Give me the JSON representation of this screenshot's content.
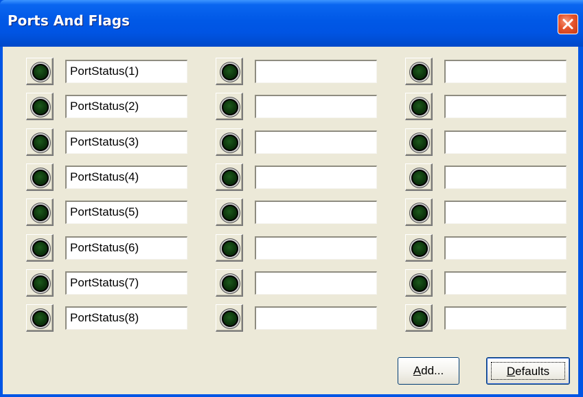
{
  "window": {
    "title": "Ports And Flags"
  },
  "icons": {
    "close": "close-icon",
    "indicator": "led-indicator-icon"
  },
  "colors": {
    "title_bar": "#0054e3",
    "client_background": "#ece9d8",
    "close_button": "#e5542c",
    "led_off": "#0d360d"
  },
  "columns": [
    {
      "rows": [
        {
          "value": "PortStatus(1)"
        },
        {
          "value": "PortStatus(2)"
        },
        {
          "value": "PortStatus(3)"
        },
        {
          "value": "PortStatus(4)"
        },
        {
          "value": "PortStatus(5)"
        },
        {
          "value": "PortStatus(6)"
        },
        {
          "value": "PortStatus(7)"
        },
        {
          "value": "PortStatus(8)"
        }
      ]
    },
    {
      "rows": [
        {
          "value": ""
        },
        {
          "value": ""
        },
        {
          "value": ""
        },
        {
          "value": ""
        },
        {
          "value": ""
        },
        {
          "value": ""
        },
        {
          "value": ""
        },
        {
          "value": ""
        }
      ]
    },
    {
      "rows": [
        {
          "value": ""
        },
        {
          "value": ""
        },
        {
          "value": ""
        },
        {
          "value": ""
        },
        {
          "value": ""
        },
        {
          "value": ""
        },
        {
          "value": ""
        },
        {
          "value": ""
        }
      ]
    }
  ],
  "buttons": {
    "add": {
      "mnemonic": "A",
      "rest": "dd..."
    },
    "defaults": {
      "mnemonic": "D",
      "rest": "efaults"
    }
  }
}
